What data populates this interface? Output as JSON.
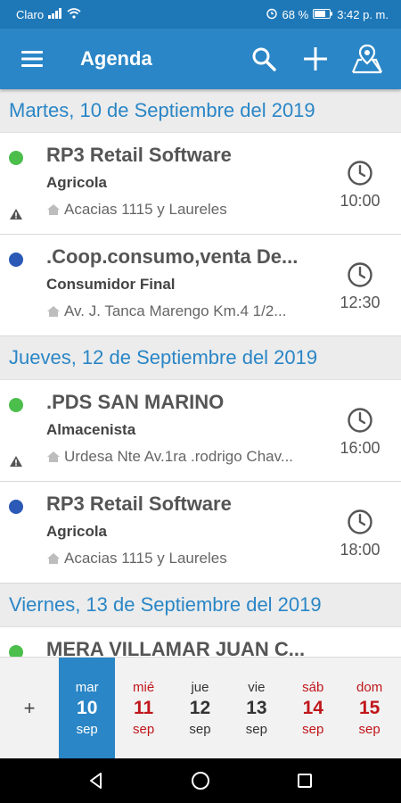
{
  "status_bar": {
    "carrier": "Claro",
    "battery": "68 %",
    "time": "3:42 p. m."
  },
  "app_bar": {
    "title": "Agenda",
    "icons": [
      "menu-icon",
      "search-icon",
      "plus-icon",
      "map-pin-icon"
    ]
  },
  "agenda": [
    {
      "date": "Martes, 10 de Septiembre del 2019",
      "events": [
        {
          "title": "RP3 Retail Software",
          "client": "Agricola",
          "address": "Acacias 1115 y Laureles",
          "time": "10:00",
          "dot_color": "#4cbe4c",
          "warning": true
        },
        {
          "title": ".Coop.consumo,venta De...",
          "client": "Consumidor Final",
          "address": "Av. J. Tanca Marengo Km.4 1/2...",
          "time": "12:30",
          "dot_color": "#2b59b5",
          "warning": false
        }
      ]
    },
    {
      "date": "Jueves, 12 de Septiembre del 2019",
      "events": [
        {
          "title": ".PDS SAN MARINO",
          "client": "Almacenista",
          "address": "Urdesa Nte Av.1ra .rodrigo Chav...",
          "time": "16:00",
          "dot_color": "#4cbe4c",
          "warning": true
        },
        {
          "title": "RP3 Retail Software",
          "client": "Agricola",
          "address": "Acacias 1115 y Laureles",
          "time": "18:00",
          "dot_color": "#2b59b5",
          "warning": false
        }
      ]
    },
    {
      "date": "Viernes, 13 de Septiembre del 2019",
      "events": [
        {
          "title": "MERA VILLAMAR JUAN C...",
          "client": "",
          "address": "",
          "time": "",
          "dot_color": "#4cbe4c",
          "warning": false
        }
      ]
    }
  ],
  "week_strip": {
    "add_label": "+",
    "days": [
      {
        "weekday": "mar",
        "day": "10",
        "month": "sep",
        "selected": true,
        "weekend": false
      },
      {
        "weekday": "mié",
        "day": "11",
        "month": "sep",
        "selected": false,
        "weekend": true
      },
      {
        "weekday": "jue",
        "day": "12",
        "month": "sep",
        "selected": false,
        "weekend": false
      },
      {
        "weekday": "vie",
        "day": "13",
        "month": "sep",
        "selected": false,
        "weekend": false
      },
      {
        "weekday": "sáb",
        "day": "14",
        "month": "sep",
        "selected": false,
        "weekend": true
      },
      {
        "weekday": "dom",
        "day": "15",
        "month": "sep",
        "selected": false,
        "weekend": true
      }
    ]
  },
  "colors": {
    "primary": "#2a86c6",
    "status_bar": "#1e78b8",
    "weekend": "#c0161b",
    "green_dot": "#4cbe4c",
    "blue_dot": "#2b59b5"
  }
}
